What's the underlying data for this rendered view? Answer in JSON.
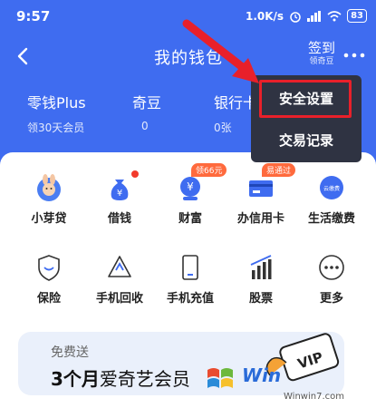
{
  "status": {
    "time": "9:57",
    "speed": "1.0K/s",
    "battery": "83"
  },
  "header": {
    "title": "我的钱包",
    "signin_label": "签到",
    "signin_sub": "领奇豆"
  },
  "assets": [
    {
      "label": "零钱Plus",
      "value": "领30天会员"
    },
    {
      "label": "奇豆",
      "value": "0"
    },
    {
      "label": "银行卡",
      "value": "0张"
    }
  ],
  "services_row1": [
    {
      "label": "小芽贷",
      "icon": "bunny-icon"
    },
    {
      "label": "借钱",
      "icon": "money-bag-icon"
    },
    {
      "label": "财富",
      "icon": "yuan-coin-icon",
      "tag": "领66元"
    },
    {
      "label": "办信用卡",
      "icon": "credit-card-icon",
      "tag": "易通过"
    },
    {
      "label": "生活缴费",
      "icon": "cloud-bill-icon"
    }
  ],
  "services_row2": [
    {
      "label": "保险",
      "icon": "shield-icon"
    },
    {
      "label": "手机回收",
      "icon": "recycle-icon"
    },
    {
      "label": "手机充值",
      "icon": "phone-icon"
    },
    {
      "label": "股票",
      "icon": "bar-chart-icon"
    },
    {
      "label": "更多",
      "icon": "more-dots-icon"
    }
  ],
  "promo": {
    "subtitle": "免费送",
    "highlight": "3个月",
    "title": "爱奇艺会员"
  },
  "menu": {
    "items": [
      "安全设置",
      "交易记录"
    ]
  },
  "watermark": {
    "brand": "Win",
    "site": "Winwin7.com"
  },
  "colors": {
    "primary": "#3f6cf0",
    "menu_bg": "#2f3342",
    "highlight": "#e8202a",
    "tag": "#ff6a3d"
  }
}
